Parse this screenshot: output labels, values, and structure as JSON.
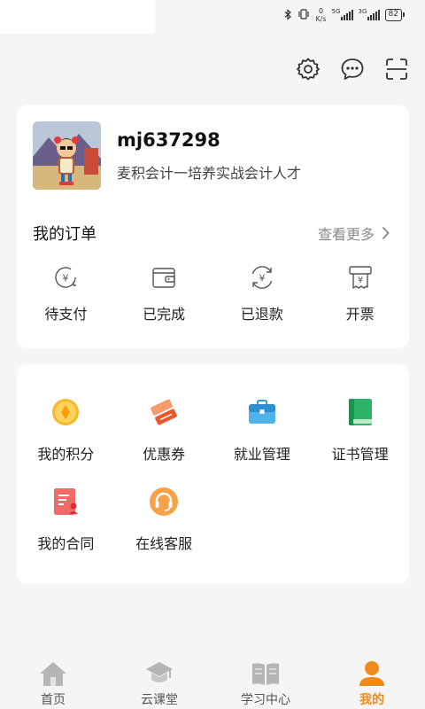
{
  "status_bar": {
    "speed_value": "0",
    "speed_unit": "K/s",
    "signal1": "5G",
    "signal2": "3G",
    "battery": "82"
  },
  "profile": {
    "username": "mj637298",
    "tagline": "麦积会计一培养实战会计人才"
  },
  "orders": {
    "title": "我的订单",
    "more_label": "查看更多",
    "items": [
      {
        "label": "待支付",
        "icon": "pending-payment-icon"
      },
      {
        "label": "已完成",
        "icon": "wallet-icon"
      },
      {
        "label": "已退款",
        "icon": "refund-icon"
      },
      {
        "label": "开票",
        "icon": "invoice-icon"
      }
    ]
  },
  "menu": {
    "items": [
      {
        "label": "我的积分",
        "icon": "points-icon"
      },
      {
        "label": "优惠券",
        "icon": "coupon-icon"
      },
      {
        "label": "就业管理",
        "icon": "briefcase-icon"
      },
      {
        "label": "证书管理",
        "icon": "certificate-book-icon"
      },
      {
        "label": "我的合同",
        "icon": "contract-icon"
      },
      {
        "label": "在线客服",
        "icon": "customer-service-icon"
      }
    ]
  },
  "tabbar": {
    "items": [
      {
        "label": "首页",
        "icon": "home-icon",
        "active": false
      },
      {
        "label": "云课堂",
        "icon": "graduation-cap-icon",
        "active": false
      },
      {
        "label": "学习中心",
        "icon": "book-icon",
        "active": false
      },
      {
        "label": "我的",
        "icon": "user-icon",
        "active": true
      }
    ]
  },
  "colors": {
    "accent": "#f08a1c",
    "background": "#f5f5f5",
    "card": "#ffffff"
  }
}
